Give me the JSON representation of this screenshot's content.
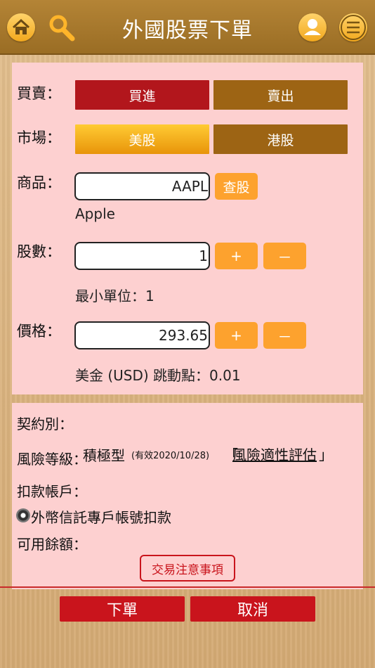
{
  "header": {
    "title": "外國股票下單"
  },
  "trade": {
    "side_label": "買賣：",
    "buy_label": "買進",
    "sell_label": "賣出",
    "market_label": "市場：",
    "us_label": "美股",
    "hk_label": "港股",
    "product_label": "商品：",
    "product_value": "AAPL",
    "lookup_label": "查股",
    "product_name": "Apple",
    "shares_label": "股數：",
    "shares_value": "1",
    "plus": "+",
    "minus": "－",
    "min_unit": "最小單位：1",
    "price_label": "價格：",
    "price_value": "293.65",
    "tick_note": "美金 (USD) 跳動點：0.01"
  },
  "account": {
    "contract_label": "契約別：",
    "risk_label": "風險等級：",
    "risk_value": "積極型",
    "risk_valid": "(有效2020/10/28)",
    "risk_link_open": "「",
    "risk_link": "風險適性評估",
    "risk_link_close": "」",
    "debit_label": "扣款帳戶：",
    "debit_option": "外幣信託專戶帳號扣款",
    "balance_label": "可用餘額：",
    "notice_label": "交易注意事項"
  },
  "footer": {
    "submit_label": "下單",
    "cancel_label": "取消"
  },
  "colors": {
    "buy": "#b2161c",
    "brown": "#9d6414",
    "orange": "#fda22e",
    "panel": "#fdd0d0"
  }
}
